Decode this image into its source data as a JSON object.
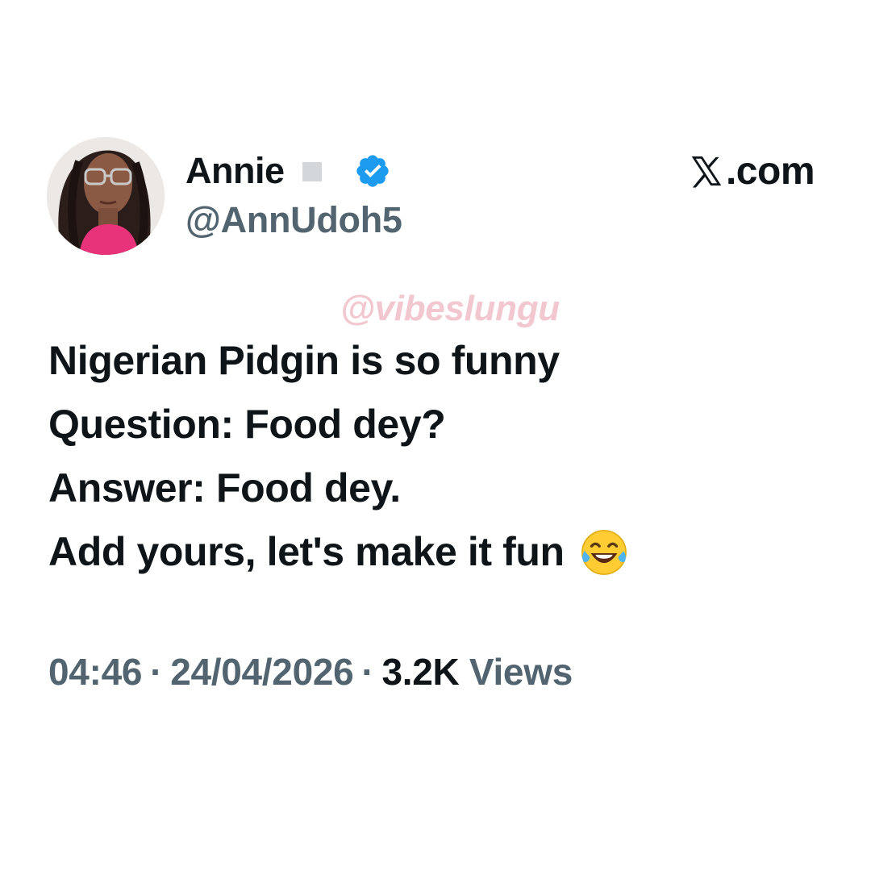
{
  "user": {
    "display_name": "Annie",
    "handle": "@AnnUdoh5",
    "verified": true,
    "avatar_icon": "profile-photo"
  },
  "brand": {
    "domain": ".com",
    "logo_icon": "x-logo-icon"
  },
  "watermark": "@vibeslungu",
  "tweet": {
    "lines": [
      "Nigerian Pidgin is so funny",
      "Question: Food dey?",
      "Answer: Food dey.",
      "Add yours, let's make it fun"
    ],
    "emoji": "face-with-tears-of-joy"
  },
  "meta": {
    "time": "04:46",
    "separator": "·",
    "date": "24/04/2026",
    "views_count": "3.2K",
    "views_label": "Views"
  },
  "colors": {
    "text": "#0f1419",
    "secondary": "#536471",
    "verified": "#1d9bf0",
    "watermark": "#f2c7cf"
  }
}
